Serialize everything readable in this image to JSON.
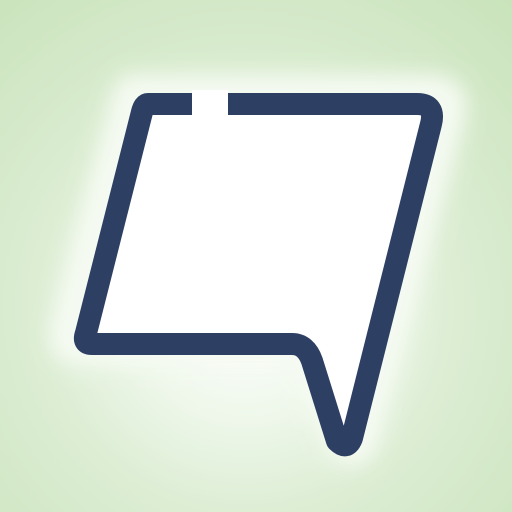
{
  "icon": {
    "name": "speech-bubble-icon",
    "colors": {
      "background_outer": "#c9e3bb",
      "background_inner": "#ffffff",
      "outline": "#2e3f64",
      "fill": "#ffffff",
      "glow": "#f6fbf3"
    }
  }
}
